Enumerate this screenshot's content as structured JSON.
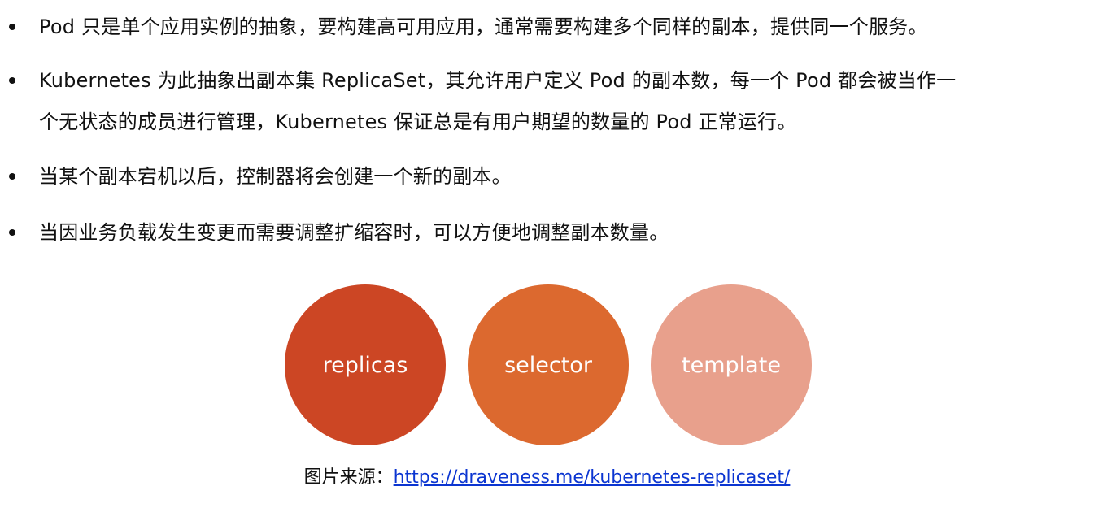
{
  "bullets": [
    {
      "lines": [
        "Pod 只是单个应用实例的抽象，要构建高可用应用，通常需要构建多个同样的副本，提供同一个服务。"
      ]
    },
    {
      "lines": [
        "Kubernetes 为此抽象出副本集 ReplicaSet，其允许用户定义 Pod 的副本数，每一个 Pod 都会被当作一",
        "个无状态的成员进行管理，Kubernetes 保证总是有用户期望的数量的 Pod 正常运行。"
      ]
    },
    {
      "lines": [
        "当某个副本宕机以后，控制器将会创建一个新的副本。"
      ]
    },
    {
      "lines": [
        "当因业务负载发生变更而需要调整扩缩容时，可以方便地调整副本数量。"
      ]
    }
  ],
  "circles": [
    {
      "label": "replicas",
      "color": "#cc4624"
    },
    {
      "label": "selector",
      "color": "#dc692f"
    },
    {
      "label": "template",
      "color": "#e8a08c"
    }
  ],
  "caption": {
    "prefix": "图片来源：",
    "link_text": "https://draveness.me/kubernetes-replicaset/",
    "link_color": "#0b35d1"
  }
}
